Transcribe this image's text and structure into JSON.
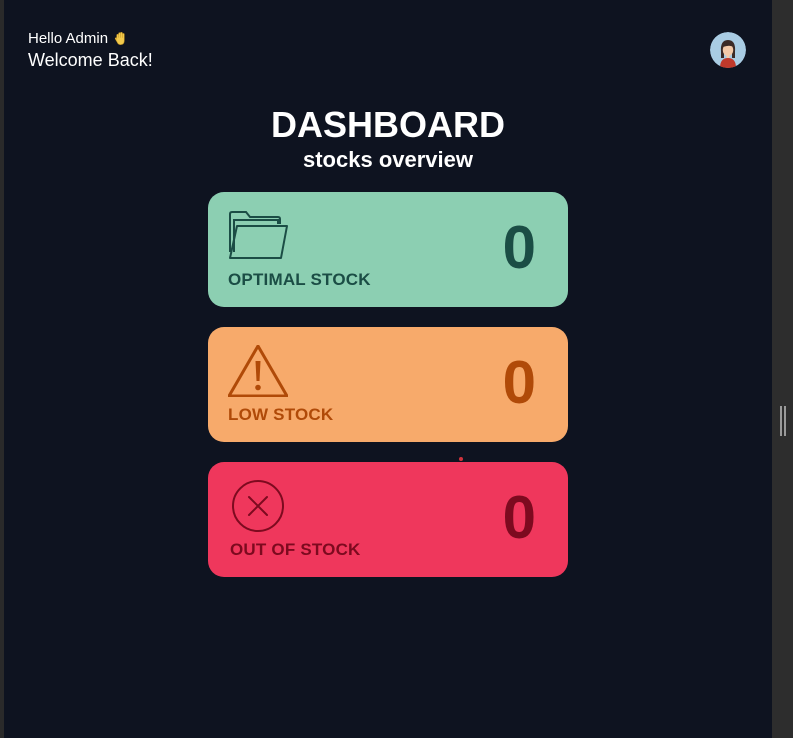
{
  "header": {
    "greeting": "Hello Admin",
    "wave_icon": "waving-hand-icon",
    "welcome": "Welcome Back!",
    "avatar_icon": "user-avatar-icon"
  },
  "dashboard": {
    "title": "DASHBOARD",
    "subtitle": "stocks overview"
  },
  "cards": [
    {
      "label": "OPTIMAL STOCK",
      "count": "0",
      "icon": "folder-icon",
      "color": "#8ccfb2",
      "text_color": "#1b4d45"
    },
    {
      "label": "LOW STOCK",
      "count": "0",
      "icon": "warning-icon",
      "color": "#f7aa6b",
      "text_color": "#b04a08"
    },
    {
      "label": "OUT OF STOCK",
      "count": "0",
      "icon": "x-circle-icon",
      "color": "#ef375c",
      "text_color": "#7d0a1f"
    }
  ],
  "colors": {
    "background": "#0e1320",
    "text": "#ffffff"
  }
}
